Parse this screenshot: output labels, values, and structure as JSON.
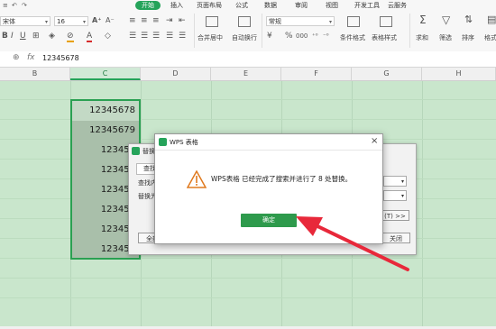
{
  "ribbon": {
    "tabs": [
      "开始",
      "插入",
      "页面布局",
      "公式",
      "数据",
      "审阅",
      "视图",
      "开发工具",
      "云服务"
    ],
    "font_name": "宋体",
    "font_size": "16",
    "number_format": "常规",
    "merge_label": "合并居中",
    "wrap_label": "自动换行",
    "cond_format_label": "条件格式",
    "table_style_label": "表格样式",
    "sum_label": "求和",
    "filter_label": "筛选",
    "sort_label": "排序",
    "format_label": "格式",
    "currency_symbol": "¥",
    "percent_symbol": "%",
    "thousands_symbol": "000"
  },
  "formula_bar": {
    "zoom_glyph": "⊕",
    "fx_label": "fx",
    "value": "12345678"
  },
  "columns": [
    "B",
    "C",
    "D",
    "E",
    "F",
    "G",
    "H"
  ],
  "cells": [
    "12345678",
    "12345679",
    "123456",
    "123456",
    "123456",
    "123456",
    "123456",
    "123456"
  ],
  "replace_dialog": {
    "title": "替换",
    "tab_find": "查找",
    "find_label": "查找内",
    "replace_label": "替换为",
    "options_label": "(T) >>",
    "replace_all_label": "全部",
    "close_label": "关闭"
  },
  "alert": {
    "title": "WPS 表格",
    "message": "WPS表格 已经完成了搜索并进行了 8 处替换。",
    "ok_label": "确定",
    "close_glyph": "×"
  },
  "colors": {
    "accent": "#25a35a",
    "sheet_overlay": "#c9e6cc",
    "ok_button": "#2e9a4c",
    "arrow": "#e8283a"
  }
}
